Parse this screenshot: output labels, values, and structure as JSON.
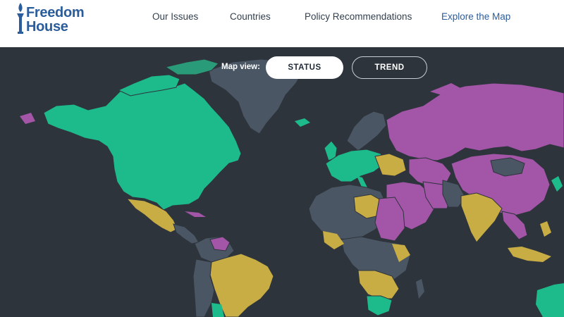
{
  "header": {
    "logo": {
      "line1": "Freedom",
      "line2": "House"
    },
    "nav": [
      {
        "label": "Our Issues"
      },
      {
        "label": "Countries"
      },
      {
        "label": "Policy Recommendations"
      },
      {
        "label": "Explore the Map"
      }
    ]
  },
  "map_view": {
    "label": "Map view:",
    "options": [
      "STATUS",
      "TREND"
    ],
    "selected": "STATUS"
  },
  "colors": {
    "free": "#1dbb8c",
    "partly_free": "#c8ad44",
    "not_free": "#a355a8",
    "no_data": "#4b5665",
    "ocean": "#2e343c",
    "brand_blue": "#2b5d9c"
  },
  "icons": [
    "torch-icon"
  ]
}
